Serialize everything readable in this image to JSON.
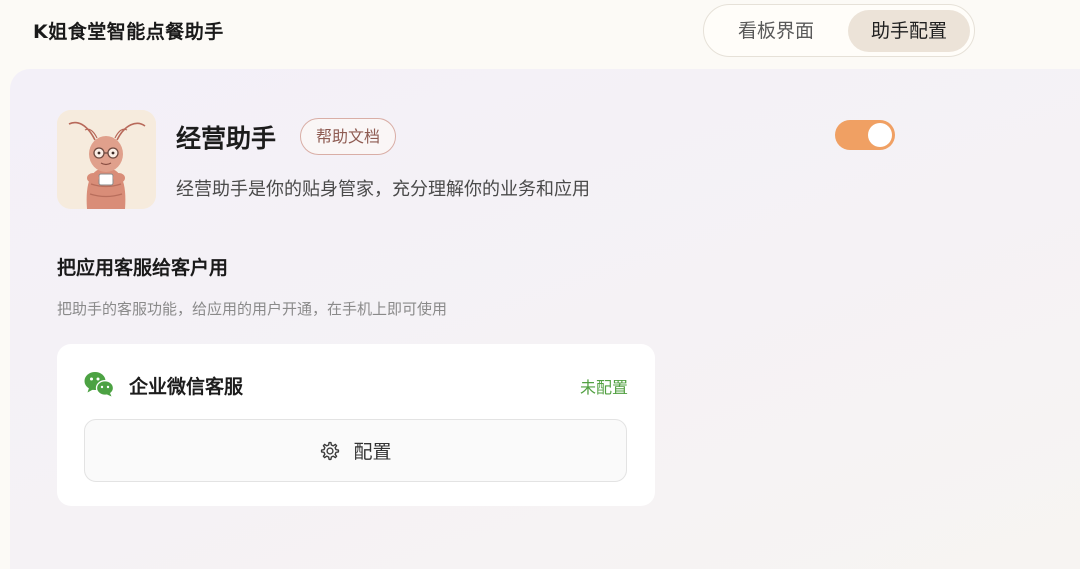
{
  "header": {
    "title": "K姐食堂智能点餐助手",
    "tabs": [
      {
        "label": "看板界面",
        "active": false
      },
      {
        "label": "助手配置",
        "active": true
      }
    ]
  },
  "assistant": {
    "avatar_icon": "shrimp-mascot-icon",
    "name": "经营助手",
    "help_link": "帮助文档",
    "description": "经营助手是你的贴身管家，充分理解你的业务和应用",
    "enabled": true
  },
  "customer_service": {
    "title": "把应用客服给客户用",
    "description": "把助手的客服功能，给应用的用户开通，在手机上即可使用",
    "channels": [
      {
        "icon": "wechat-icon",
        "name": "企业微信客服",
        "status": "未配置",
        "button_label": "配置"
      }
    ]
  },
  "colors": {
    "toggle_on": "#f0a063",
    "status_green": "#52a042",
    "help_border": "#d9aea6"
  }
}
